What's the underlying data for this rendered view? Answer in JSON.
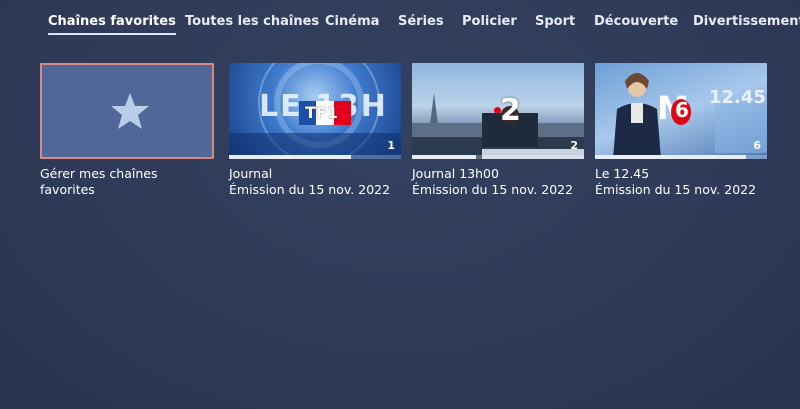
{
  "nav": {
    "tabs": [
      {
        "label": "Chaînes favorites",
        "active": true
      },
      {
        "label": "Toutes les chaînes",
        "active": false
      },
      {
        "label": "Cinéma",
        "active": false
      },
      {
        "label": "Séries",
        "active": false
      },
      {
        "label": "Policier",
        "active": false
      },
      {
        "label": "Sport",
        "active": false
      },
      {
        "label": "Découverte",
        "active": false
      },
      {
        "label": "Divertissement",
        "active": false
      }
    ]
  },
  "favorites_card": {
    "label": "Gérer mes chaînes favorites",
    "icon": "star-icon"
  },
  "programs": [
    {
      "title": "Journal",
      "subtitle": "Émission du 15 nov. 2022",
      "channel_number": "1",
      "channel_logo": "TF1",
      "logo_overlay": "LE 13H",
      "progress": 0.71
    },
    {
      "title": "Journal 13h00",
      "subtitle": "Émission du 15 nov. 2022",
      "channel_number": "2",
      "channel_logo": ".2",
      "progress": 0.37
    },
    {
      "title": "Le 12.45",
      "subtitle": "Émission du 15 nov. 2022",
      "channel_number": "6",
      "channel_logo": "M6",
      "logo_overlay": "12.45",
      "progress": 0.88
    }
  ],
  "colors": {
    "background": "#2f3b59",
    "favorites_tile": "#4f6899",
    "favorites_border": "#d88a82",
    "tf1_red": "#e2001a",
    "tf1_blue": "#1d4fa5",
    "m6_red": "#e30613"
  }
}
